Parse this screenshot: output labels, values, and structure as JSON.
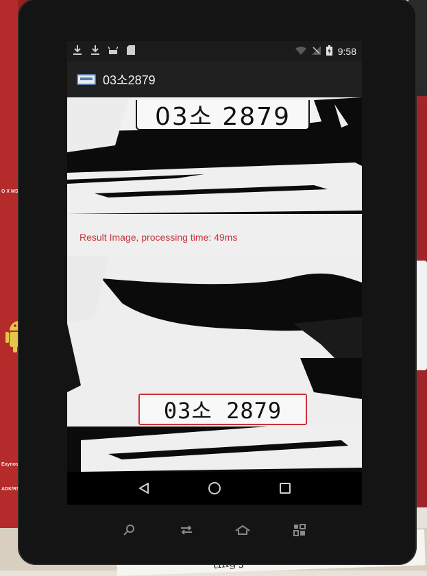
{
  "status_bar": {
    "time": "9:58",
    "icons": [
      "download-icon",
      "download-icon",
      "android-icon",
      "sd-card-icon",
      "wifi-icon",
      "no-sim-icon",
      "battery-charging-icon"
    ]
  },
  "app_bar": {
    "title": "03소2879",
    "icon": "license-plate-icon"
  },
  "result": {
    "text": "Result Image, processing time: 49ms",
    "top_plate_text": "03소 2879",
    "detected_plate_text": "03소 2879"
  },
  "nav_bar": {
    "buttons": [
      "back-icon",
      "home-icon",
      "recents-icon"
    ]
  },
  "hardware_keys": [
    "search-icon",
    "switch-icon",
    "home-key-icon",
    "menu-icon"
  ],
  "scene": {
    "board_labels": [
      "O X MS",
      "Exynos",
      "ADK/RSP"
    ],
    "paper_text": "ting Johnson Counters"
  },
  "colors": {
    "result_text": "#c9323a",
    "detection_box": "#c9323a",
    "board_red": "#9a1e22"
  }
}
